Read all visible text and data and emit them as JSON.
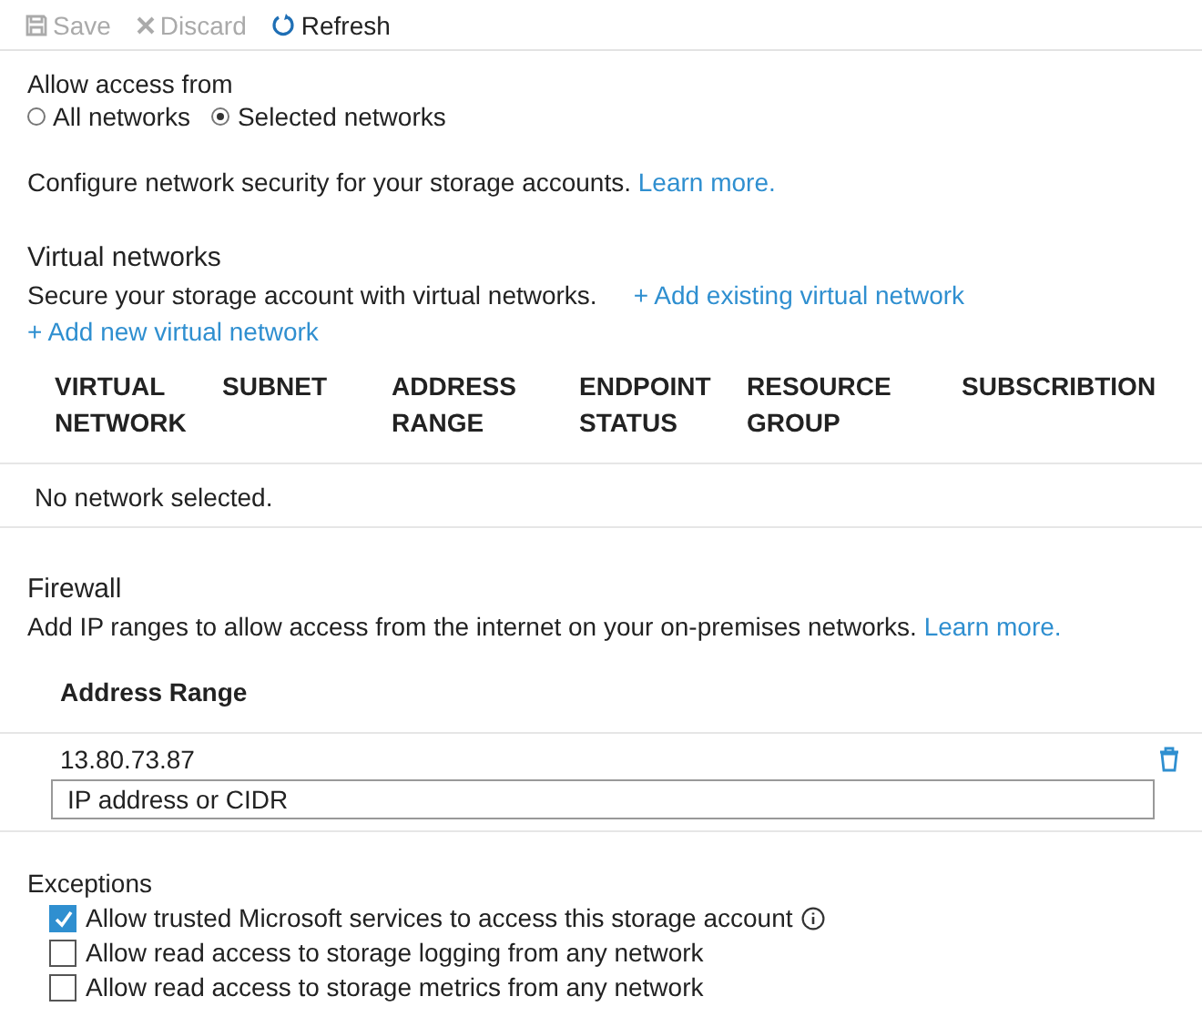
{
  "toolbar": [
    {
      "kind": "save",
      "label": "Save",
      "disabled": true
    },
    {
      "kind": "discard",
      "label": "Discard",
      "disabled": true
    },
    {
      "kind": "refresh",
      "label": "Refresh",
      "disabled": false
    }
  ],
  "access": {
    "label": "Allow access from",
    "options": [
      {
        "label": "All networks",
        "selected": false
      },
      {
        "label": "Selected networks",
        "selected": true
      }
    ]
  },
  "configure": {
    "text": "Configure network security for your storage accounts.",
    "link": "Learn more."
  },
  "virtual_networks": {
    "title": "Virtual networks",
    "description": "Secure your storage account with virtual networks.",
    "add_existing": "+ Add existing virtual network",
    "add_new": "+ Add new virtual network",
    "columns": [
      [
        "VIRTUAL",
        "NETWORK"
      ],
      [
        "SUBNET"
      ],
      [
        "ADDRESS",
        "RANGE"
      ],
      [
        "ENDPOINT",
        "STATUS"
      ],
      [
        "RESOURCE",
        "GROUP"
      ],
      [
        "SUBSCRIBTION"
      ]
    ],
    "empty": "No network selected."
  },
  "firewall": {
    "title": "Firewall",
    "description": "Add IP ranges to allow access from the internet on your on-premises networks.",
    "link": "Learn more.",
    "column": "Address Range",
    "rows": [
      "13.80.73.87"
    ],
    "placeholder": "IP address or CIDR"
  },
  "exceptions": {
    "title": "Exceptions",
    "items": [
      {
        "label": "Allow trusted Microsoft services to access this storage account",
        "checked": true,
        "info": true
      },
      {
        "label": "Allow read access to storage logging from any network",
        "checked": false,
        "info": false
      },
      {
        "label": "Allow read access to storage metrics from any network",
        "checked": false,
        "info": false
      }
    ]
  }
}
